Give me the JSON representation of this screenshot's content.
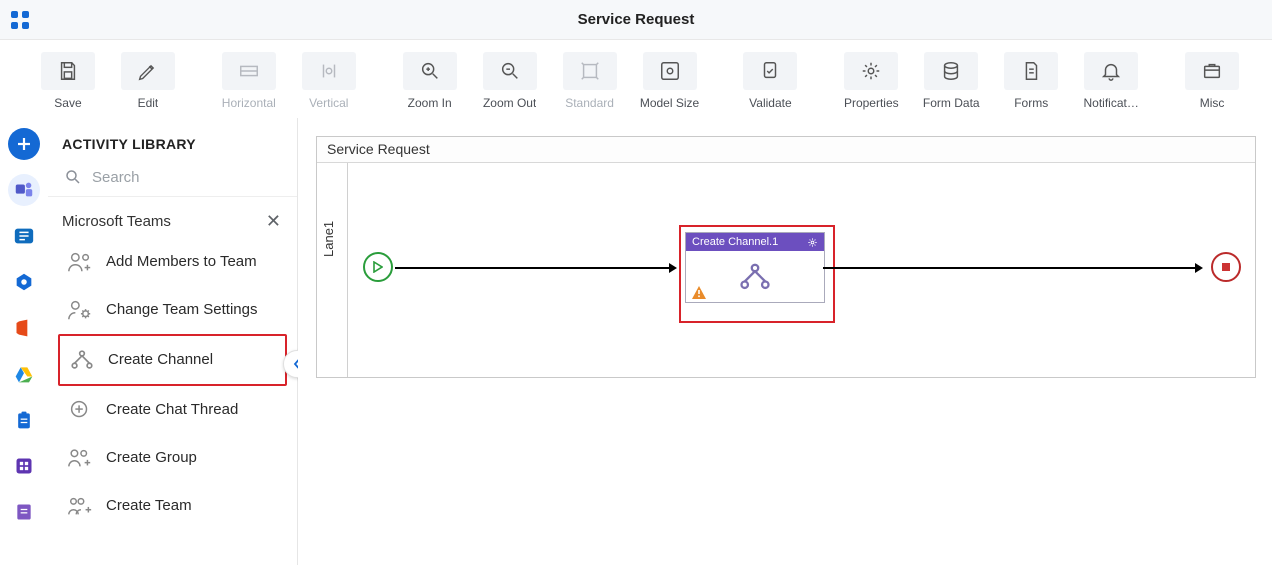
{
  "header": {
    "title": "Service Request"
  },
  "toolbar": {
    "save": "Save",
    "edit": "Edit",
    "horizontal": "Horizontal",
    "vertical": "Vertical",
    "zoom_in": "Zoom In",
    "zoom_out": "Zoom Out",
    "standard": "Standard",
    "model_size": "Model Size",
    "validate": "Validate",
    "properties": "Properties",
    "form_data": "Form Data",
    "forms": "Forms",
    "notifications": "Notificat…",
    "misc": "Misc"
  },
  "panel": {
    "title": "ACTIVITY LIBRARY",
    "search_placeholder": "Search",
    "group": "Microsoft Teams",
    "items": [
      "Add Members to Team",
      "Change Team Settings",
      "Create Channel",
      "Create Chat Thread",
      "Create Group",
      "Create Team"
    ],
    "selected_index": 2
  },
  "canvas": {
    "process_name": "Service Request",
    "lane": "Lane1",
    "node": {
      "title": "Create Channel.1"
    }
  },
  "colors": {
    "accent_blue": "#1469d4",
    "highlight_red": "#d8232a",
    "node_header_purple": "#6c4fbf",
    "start_green": "#2a9d3b",
    "end_red": "#bb2a2a"
  }
}
